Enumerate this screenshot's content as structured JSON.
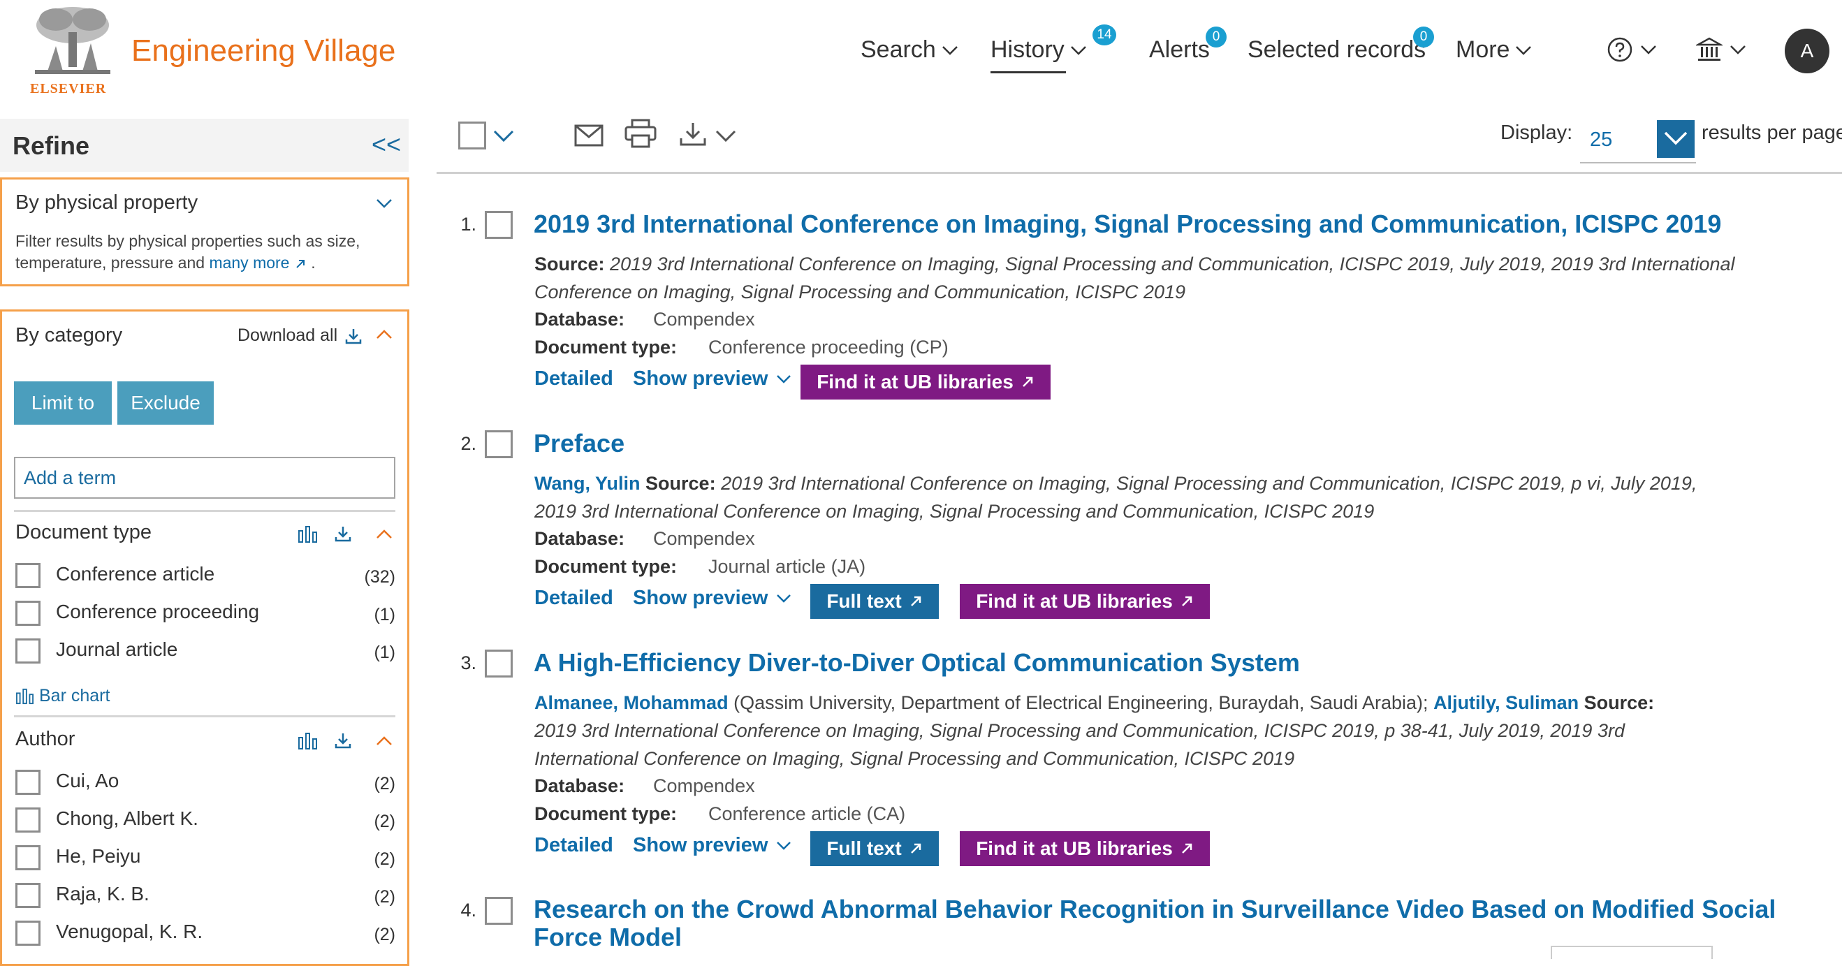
{
  "header": {
    "brand": "Engineering Village",
    "publisher": "ELSEVIER",
    "nav": {
      "search": "Search",
      "history": "History",
      "history_badge": "14",
      "alerts": "Alerts",
      "alerts_badge": "0",
      "selected": "Selected records",
      "selected_badge": "0",
      "more": "More"
    },
    "avatar": "A"
  },
  "sidebar": {
    "title": "Refine",
    "collapse": "<<",
    "physical": {
      "title": "By physical property",
      "desc_line1": "Filter results by physical properties such as size,",
      "desc_line2": "temperature, pressure and",
      "more_link": "many more",
      "period": "."
    },
    "category": {
      "title": "By category",
      "download_all": "Download all",
      "limit_to": "Limit to",
      "exclude": "Exclude",
      "term_placeholder": "Add a term"
    },
    "document_type": {
      "title": "Document type",
      "items": [
        {
          "label": "Conference article",
          "count": "(32)"
        },
        {
          "label": "Conference proceeding",
          "count": "(1)"
        },
        {
          "label": "Journal article",
          "count": "(1)"
        }
      ],
      "bar_chart": "Bar chart"
    },
    "author": {
      "title": "Author",
      "items": [
        {
          "label": "Cui, Ao",
          "count": "(2)"
        },
        {
          "label": "Chong, Albert K.",
          "count": "(2)"
        },
        {
          "label": "He, Peiyu",
          "count": "(2)"
        },
        {
          "label": "Raja, K. B.",
          "count": "(2)"
        },
        {
          "label": "Venugopal, K. R.",
          "count": "(2)"
        }
      ]
    }
  },
  "toolbar": {
    "display_label": "Display:",
    "display_value": "25",
    "per_page": "results per page"
  },
  "labels": {
    "source": "Source:",
    "database": "Database:",
    "doctype": "Document type:",
    "detailed": "Detailed",
    "show_preview": "Show preview",
    "find_ub": "Find it at UB libraries",
    "full_text": "Full text"
  },
  "results": [
    {
      "num": "1.",
      "title": "2019 3rd International Conference on Imaging, Signal Processing and Communication, ICISPC 2019",
      "source_line1": "2019 3rd International Conference on Imaging, Signal Processing and Communication, ICISPC 2019, July 2019, 2019 3rd International",
      "source_line2": "Conference on Imaging, Signal Processing and Communication, ICISPC 2019",
      "database": "Compendex",
      "doctype": "Conference proceeding (CP)"
    },
    {
      "num": "2.",
      "title": "Preface",
      "author": "Wang, Yulin",
      "source_line1": "2019 3rd International Conference on Imaging, Signal Processing and Communication, ICISPC 2019, p vi, July 2019,",
      "source_line2": "2019 3rd International Conference on Imaging, Signal Processing and Communication, ICISPC 2019",
      "database": "Compendex",
      "doctype": "Journal article (JA)"
    },
    {
      "num": "3.",
      "title": "A High-Efficiency Diver-to-Diver Optical Communication System",
      "author1": "Almanee, Mohammad",
      "affiliation": "(Qassim University, Department of Electrical Engineering, Buraydah, Saudi Arabia);",
      "author2": "Aljutily, Suliman",
      "source_line1": "2019 3rd International Conference on Imaging, Signal Processing and Communication, ICISPC 2019, p 38-41, July 2019, 2019 3rd",
      "source_line2": "International Conference on Imaging, Signal Processing and Communication, ICISPC 2019",
      "database": "Compendex",
      "doctype": "Conference article (CA)"
    },
    {
      "num": "4.",
      "title_line1": "Research on the Crowd Abnormal Behavior Recognition in Surveillance Video Based on Modified Social",
      "title_line2": "Force Model"
    }
  ]
}
